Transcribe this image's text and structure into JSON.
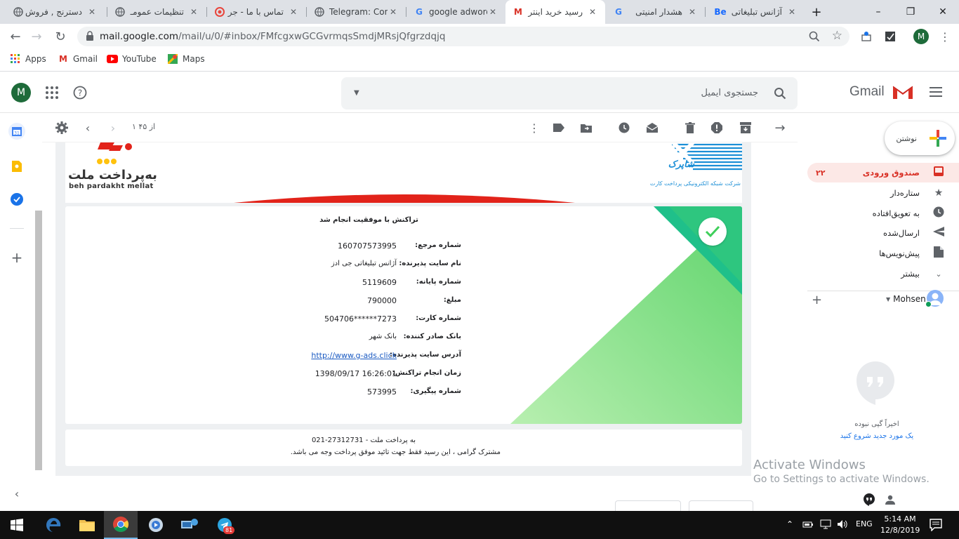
{
  "browser": {
    "tabs": [
      {
        "title": "دسترنج , فروش",
        "icon": "globe-icon"
      },
      {
        "title": "تنظیمات عمومـ",
        "icon": "globe-icon"
      },
      {
        "title": "تماس با ما - جر",
        "icon": "red-circle-icon"
      },
      {
        "title": "Telegram: Cont",
        "icon": "globe-icon"
      },
      {
        "title": "google adword",
        "icon": "google-icon"
      },
      {
        "title": "رسید خرید اینتر",
        "icon": "gmail-icon"
      },
      {
        "title": "هشدار امنیتی",
        "icon": "google-icon"
      },
      {
        "title": "آژانس تبلیغاتی",
        "icon": "behance-icon"
      }
    ],
    "url_host": "mail.google.com",
    "url_path": "/mail/u/0/#inbox/FMfcgxwGCGvrmqsSmdjMRsjQfgrzdqjq",
    "profile_initial": "M",
    "bookmarks": [
      {
        "label": "Apps"
      },
      {
        "label": "Gmail"
      },
      {
        "label": "YouTube"
      },
      {
        "label": "Maps"
      }
    ]
  },
  "gmail": {
    "search_placeholder": "جستجوی ایمیل",
    "logo_text": "Gmail",
    "pagination": "۱ از ۴۵",
    "compose_label": "نوشتن",
    "nav": [
      {
        "label": "صندوق ورودی",
        "count": "۲۲",
        "icon": "inbox-icon"
      },
      {
        "label": "ستاره‌دار",
        "icon": "star-icon"
      },
      {
        "label": "به تعویق‌افتاده",
        "icon": "clock-icon"
      },
      {
        "label": "ارسال‌شده",
        "icon": "send-icon"
      },
      {
        "label": "پیش‌نویس‌ها",
        "icon": "draft-icon"
      },
      {
        "label": "بیشتر",
        "icon": "chevron-down-icon"
      }
    ],
    "hangouts_user": "Mohsen",
    "hangouts_empty": "اخیراً گپی نبوده",
    "hangouts_start": "یک مورد جدید شروع کنید"
  },
  "receipt": {
    "mellat_brand_fa": "به‌پرداخت ملت",
    "mellat_brand_en": "beh pardakht mellat",
    "shaparak_brand": "شاپرک",
    "shaparak_sub": "شرکت شبکه الکترونیکی پرداخت کارت",
    "status": "تراکنش با موفقیت انجام شد",
    "fields": [
      {
        "label": "شماره مرجع:",
        "value": "160707573995"
      },
      {
        "label": "نام سایت پذیرنده:",
        "value": "آژانس تبلیغاتی جی ادز"
      },
      {
        "label": "شماره پایانه:",
        "value": "5119609"
      },
      {
        "label": "مبلغ:",
        "value": "790000"
      },
      {
        "label": "شماره کارت:",
        "value": "504706******7273"
      },
      {
        "label": "بانک صادر کننده:",
        "value": "بانک شهر"
      },
      {
        "label": "آدرس سایت پذیرنده:",
        "value": "http://www.g-ads.click"
      },
      {
        "label": "زمان انجام تراکنش:",
        "value": "1398/09/17 16:26:01"
      },
      {
        "label": "شماره پیگیری:",
        "value": "573995"
      }
    ],
    "footer_line1": "به پرداخت ملت - 27312731-021",
    "footer_line2": "مشترک گرامی ، این رسید فقط جهت تائید موفق پرداخت وجه می باشد."
  },
  "watermark": {
    "line1": "Activate Windows",
    "line2": "Go to Settings to activate Windows."
  },
  "taskbar": {
    "lang": "ENG",
    "time": "5:14 AM",
    "date": "12/8/2019",
    "telegram_badge": "81"
  },
  "colors": {
    "gmail_red": "#d93025",
    "success_green": "#3ecf5a",
    "link_blue": "#1a5ac2",
    "shaparak_blue": "#1c8fd6"
  }
}
